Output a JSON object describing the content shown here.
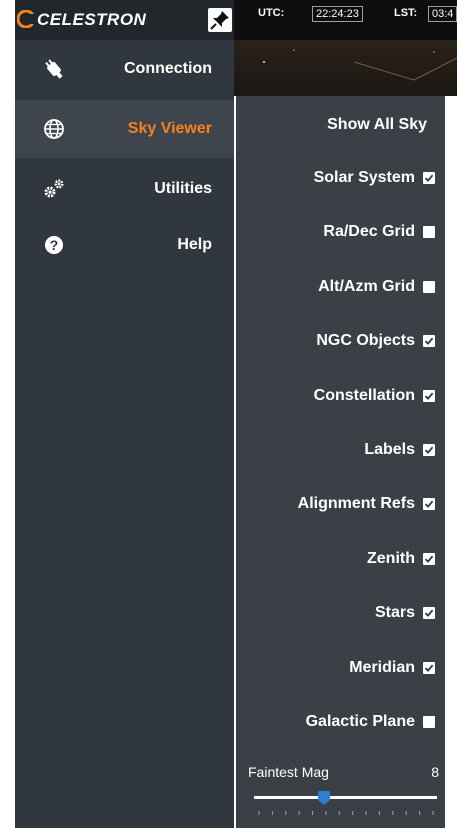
{
  "brand": {
    "name": "CELESTRON",
    "trademark": "®"
  },
  "nav": [
    {
      "label": "Connection",
      "icon": "usb-plug-icon",
      "active": false
    },
    {
      "label": "Sky Viewer",
      "icon": "globe-icon",
      "active": true
    },
    {
      "label": "Utilities",
      "icon": "gears-icon",
      "active": false
    },
    {
      "label": "Help",
      "icon": "question-icon",
      "active": false
    }
  ],
  "header": {
    "utc_label": "UTC:",
    "utc_value": "22:24:23",
    "lst_label": "LST:",
    "lst_value": "03:4"
  },
  "panel": {
    "show_all": "Show All Sky",
    "options": [
      {
        "label": "Solar System",
        "checked": true
      },
      {
        "label": "Ra/Dec Grid",
        "checked": false
      },
      {
        "label": "Alt/Azm Grid",
        "checked": false
      },
      {
        "label": "NGC Objects",
        "checked": true
      },
      {
        "label": "Constellation",
        "checked": true
      },
      {
        "label": "Labels",
        "checked": true
      },
      {
        "label": "Alignment Refs",
        "checked": true
      },
      {
        "label": "Zenith",
        "checked": true
      },
      {
        "label": "Stars",
        "checked": true
      },
      {
        "label": "Meridian",
        "checked": true
      },
      {
        "label": "Galactic Plane",
        "checked": false
      }
    ],
    "faintest_mag_label": "Faintest Mag",
    "faintest_mag_value": "8",
    "slider_fraction": 0.38
  },
  "colors": {
    "accent": "#f5821f",
    "sidebar_bg": "#31373e",
    "panel_bg": "#3a4046",
    "slider_thumb": "#2f7fd0"
  }
}
